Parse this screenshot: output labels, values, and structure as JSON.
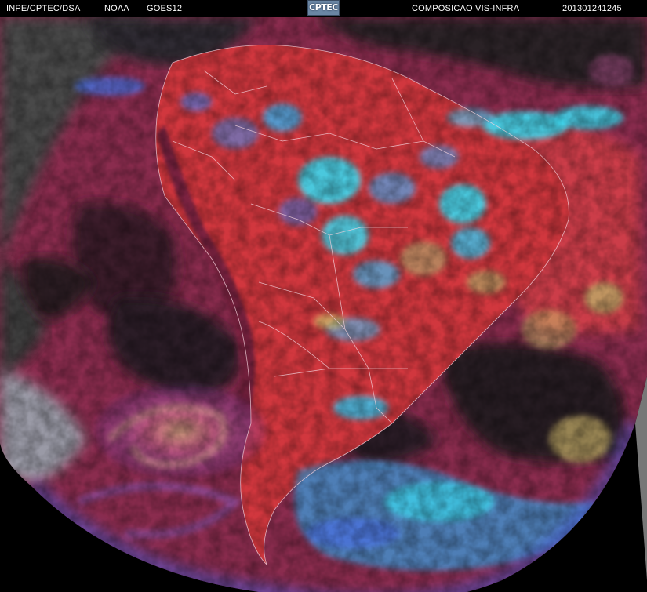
{
  "header": {
    "source": "INPE/CPTEC/DSA",
    "agency": "NOAA",
    "satellite": "GOES12",
    "logo_text": "CPTEC",
    "product": "COMPOSICAO VIS-INFRA",
    "timestamp": "201301241245"
  },
  "colors": {
    "background": "#000000",
    "space_gray": "#6e6e6e",
    "ocean_dark": "#252525",
    "clear_sky_surface": "#b8304f",
    "land_warm": "#d43a3f",
    "high_cloud_cyan": "#3ad8ee",
    "mid_cloud_blue": "#4a6fe0",
    "low_cloud_yellow": "#c8c06a",
    "border_lines": "#f4d2dc",
    "logo_blue": "#6a86a4"
  },
  "image": {
    "description_icon": "satellite-earth-disk-icon"
  }
}
